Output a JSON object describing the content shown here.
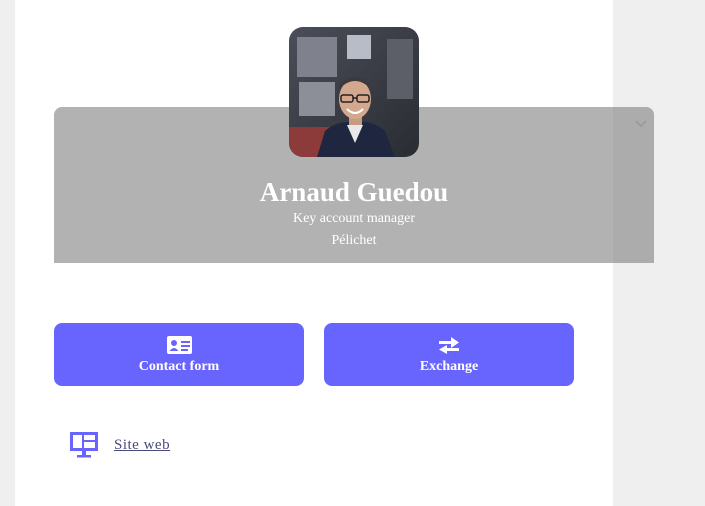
{
  "profile": {
    "name": "Arnaud Guedou",
    "role": "Key account manager",
    "company": "Pélichet"
  },
  "actions": {
    "contact_label": "Contact form",
    "exchange_label": "Exchange"
  },
  "links": {
    "site_label": "Site web"
  },
  "colors": {
    "accent": "#6865ff",
    "header_bg": "#b2b2b2",
    "side_panel": "#efefef"
  },
  "icons": {
    "contact": "id-card-icon",
    "exchange": "exchange-arrows-icon",
    "site": "desktop-monitor-icon",
    "header_toggle": "chevron-down-icon"
  }
}
